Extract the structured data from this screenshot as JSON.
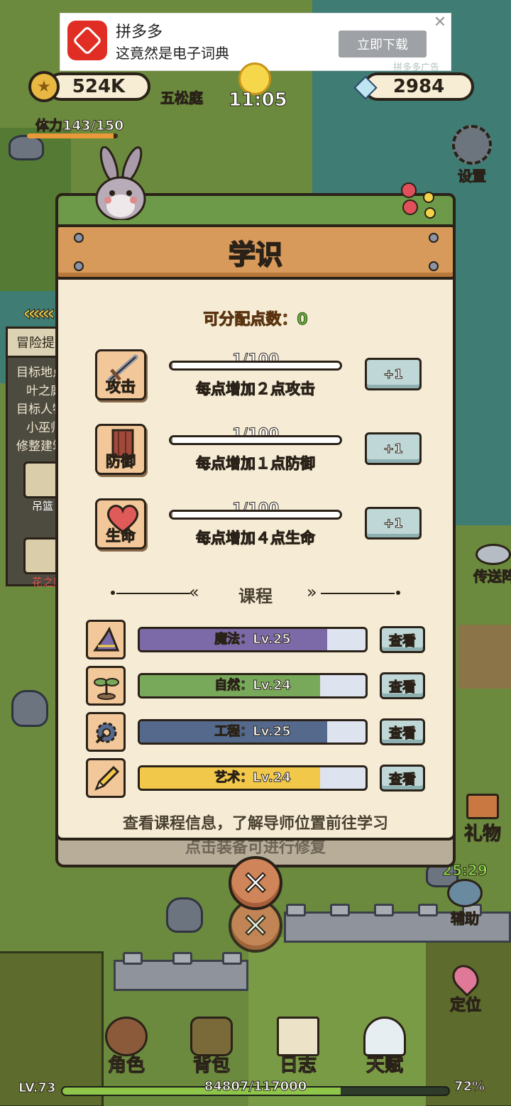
{
  "ad": {
    "brand": "拼多多",
    "slogan": "这竟然是电子词典",
    "download_label": "立即下载",
    "close_symbol": "✕",
    "tag": "拼多多广告"
  },
  "hud": {
    "coins": "524K",
    "gems": "2984",
    "location": "五松庭",
    "time": "11:05",
    "stamina_label": "体力143/150",
    "stamina_fraction": 0.953
  },
  "side_buttons": {
    "settings": "设置",
    "teleport": "传送阵",
    "gift": "礼物",
    "assist": "辅助",
    "assist_timer": "25:29",
    "locate": "定位"
  },
  "quest": {
    "header": "冒险提示",
    "lines": [
      "目标地点",
      "叶之庭",
      "目标人物",
      "小巫师",
      "修整建筑"
    ],
    "slot1_label": "吊篮",
    "slot2_label": "花之庭"
  },
  "dialog": {
    "title": "学识",
    "points_label": "可分配点数：",
    "points_value": "0",
    "stats": [
      {
        "name": "攻击",
        "value": "1/100",
        "fraction": 0.01,
        "desc": "每点增加２点攻击",
        "button": "+1"
      },
      {
        "name": "防御",
        "value": "1/100",
        "fraction": 0.01,
        "desc": "每点增加１点防御",
        "button": "+1"
      },
      {
        "name": "生命",
        "value": "1/100",
        "fraction": 0.01,
        "desc": "每点增加４点生命",
        "button": "+1"
      }
    ],
    "course_section_title": "课程",
    "courses": [
      {
        "label": "魔法：Lv.25",
        "fraction": 0.83,
        "color": "#7c6aa8",
        "button": "查看"
      },
      {
        "label": "自然：Lv.24",
        "fraction": 0.8,
        "color": "#78a85a",
        "button": "查看"
      },
      {
        "label": "工程：Lv.25",
        "fraction": 0.83,
        "color": "#54698c",
        "button": "查看"
      },
      {
        "label": "艺术：Lv.24",
        "fraction": 0.8,
        "color": "#f2c84a",
        "button": "查看"
      }
    ],
    "course_hint": "查看课程信息，了解导师位置前往学习",
    "behind_hint": "点击装备可进行修复",
    "close_symbol": "✕"
  },
  "bottom_nav": {
    "items": [
      "角色",
      "背包",
      "日志",
      "天赋"
    ],
    "level": "LV.73",
    "xp_text": "84807/117000",
    "xp_percent": "72%",
    "xp_fraction": 0.72
  },
  "colors": {
    "panel": "#f6ecd6",
    "plank": "#d89a5a",
    "outline": "#2a2218",
    "accent_orange": "#e08a24",
    "accent_green": "#6ab03c"
  }
}
